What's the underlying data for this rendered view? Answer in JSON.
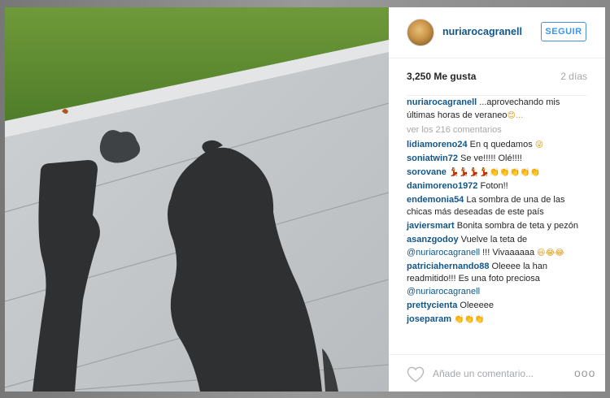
{
  "post": {
    "username": "nuriarocagranell",
    "follow_label": "SEGUIR",
    "likes": "3,250 Me gusta",
    "age": "2 días"
  },
  "caption": {
    "user": "nuriarocagranell",
    "text": " ...aprovechando mis últimas horas de veraneo",
    "emoji": "😊..."
  },
  "view_all": "ver los 216 comentarios",
  "comments": [
    {
      "user": "lidiamoreno24",
      "text": " En q quedamos ",
      "emoji": "😜"
    },
    {
      "user": "soniatwin72",
      "text": " Se ve!!!!! Olé!!!!",
      "emoji": ""
    },
    {
      "user": "sorovane",
      "text": " ",
      "emoji": "💃💃💃💃👏👏👏👏👏"
    },
    {
      "user": "danimoreno1972",
      "text": " Foton!!",
      "emoji": ""
    },
    {
      "user": "endemonia54",
      "text": " La sombra de una de las chicas más deseadas de este país",
      "emoji": ""
    },
    {
      "user": "javiersmart",
      "text": " Bonita sombra de teta y pezón",
      "emoji": ""
    },
    {
      "user": "asanzgodoy",
      "text": " Vuelve la teta de ",
      "mention": "@nuriarocagranell",
      "text2": " !!! Vivaaaaaa ",
      "emoji": "😃😂😂"
    },
    {
      "user": "patriciahernando88",
      "text": " Oleeee la han readmitido!!! Es una foto preciosa ",
      "mention": "@nuriarocagranell",
      "text2": "",
      "emoji": ""
    },
    {
      "user": "prettycienta",
      "text": " Oleeeee",
      "emoji": ""
    },
    {
      "user": "joseparam",
      "text": " ",
      "emoji": "👏👏👏"
    }
  ],
  "footer": {
    "add_comment_placeholder": "Añade un comentario...",
    "more_label": "ooo"
  },
  "icons": [
    "heart-icon",
    "more-options-icon"
  ],
  "colors": {
    "username": "#125688",
    "follow": "#3897f0",
    "muted": "#a5a7aa"
  }
}
